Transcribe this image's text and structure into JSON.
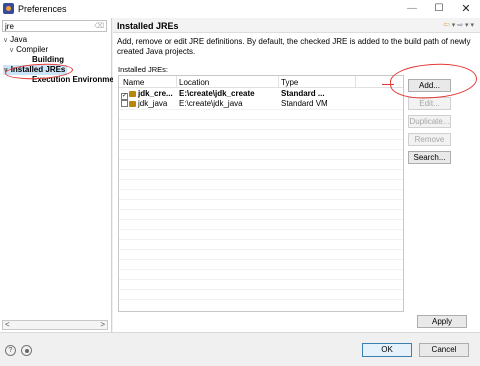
{
  "window": {
    "title": "Preferences",
    "controls": {
      "minimize": "—",
      "maximize": "☐",
      "close": "✕"
    }
  },
  "left_pane": {
    "filter_value": "jre",
    "tree": [
      {
        "label": "Java",
        "toggle": "∨"
      },
      {
        "label": "Compiler",
        "toggle": "∨"
      },
      {
        "label": "Building",
        "toggle": ""
      },
      {
        "label": "Installed JREs",
        "toggle": "∨"
      },
      {
        "label": "Execution Environme",
        "toggle": ""
      }
    ],
    "scroll_left": "<",
    "scroll_right": ">"
  },
  "right_pane": {
    "title": "Installed JREs",
    "nav_back": "⇦",
    "nav_rest": "▾ ⇨ ▾ ▾",
    "description": "Add, remove or edit JRE definitions. By default, the checked JRE is added to the build path of newly created Java projects.",
    "jres_label": "Installed JREs:",
    "columns": {
      "name": "Name",
      "location": "Location",
      "type": "Type"
    },
    "rows": [
      {
        "checked": true,
        "check_mark": "✓",
        "name": "jdk_cre...",
        "location": "E:\\create\\jdk_create",
        "type": "Standard ..."
      },
      {
        "checked": false,
        "check_mark": "",
        "name": "jdk_java",
        "location": "E:\\create\\jdk_java",
        "type": "Standard VM"
      }
    ],
    "buttons": {
      "add": "Add...",
      "edit": "Edit...",
      "duplicate": "Duplicate...",
      "remove": "Remove",
      "search": "Search..."
    },
    "apply": "Apply"
  },
  "bottom": {
    "help_icon": "?",
    "ok": "OK",
    "cancel": "Cancel"
  },
  "colors": {
    "annotation": "#e53935",
    "selection": "#cce4f7",
    "jre_icon": "#b8860b"
  }
}
